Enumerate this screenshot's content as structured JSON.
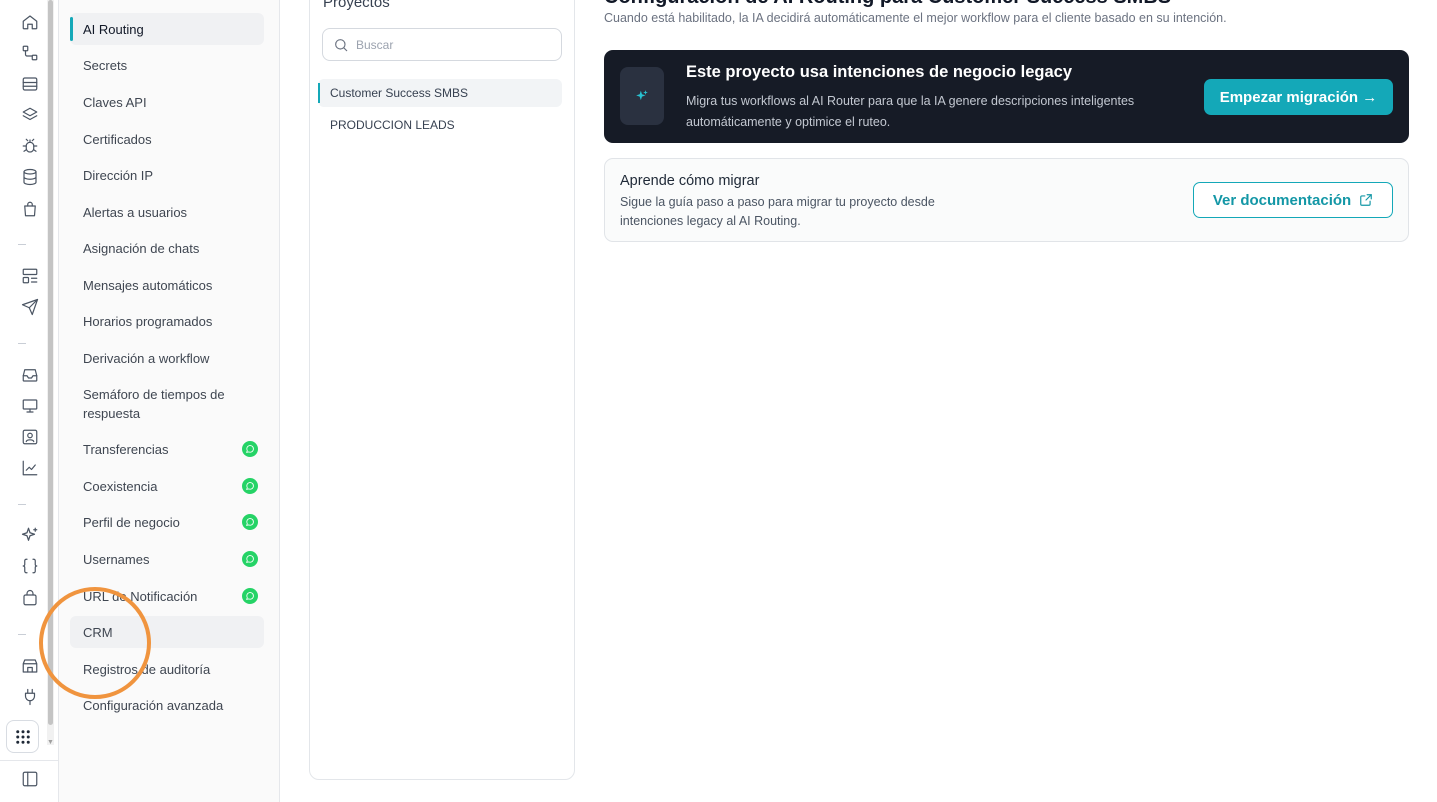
{
  "rail": {
    "icons": [
      "home-icon",
      "workflow-icon",
      "archive-icon",
      "layers-icon",
      "bug-icon",
      "database-icon",
      "shopping-bag-icon",
      "layout-list-icon",
      "send-icon",
      "inbox-icon",
      "monitor-icon",
      "contact-icon",
      "chart-line-icon",
      "sparkles-icon",
      "braces-icon",
      "shopping-basket-icon",
      "store-icon",
      "plug-icon",
      "apps-grid-icon",
      "sidebar-toggle-icon"
    ]
  },
  "nav": {
    "items": [
      {
        "label": "AI Routing",
        "active": true
      },
      {
        "label": "Secrets"
      },
      {
        "label": "Claves API"
      },
      {
        "label": "Certificados"
      },
      {
        "label": "Dirección IP"
      },
      {
        "label": "Alertas a usuarios"
      },
      {
        "label": "Asignación de chats"
      },
      {
        "label": "Mensajes automáticos"
      },
      {
        "label": "Horarios programados"
      },
      {
        "label": "Derivación a workflow"
      },
      {
        "label": "Semáforo de tiempos de respuesta"
      },
      {
        "label": "Transferencias",
        "badge": "whatsapp-icon"
      },
      {
        "label": "Coexistencia",
        "badge": "whatsapp-icon"
      },
      {
        "label": "Perfil de negocio",
        "badge": "whatsapp-icon"
      },
      {
        "label": "Usernames",
        "badge": "whatsapp-icon"
      },
      {
        "label": "URL de Notificación",
        "badge": "whatsapp-icon"
      },
      {
        "label": "CRM",
        "hover": true
      },
      {
        "label": "Registros de auditoría"
      },
      {
        "label": "Configuración avanzada"
      }
    ]
  },
  "projects": {
    "title": "Proyectos",
    "search_placeholder": "Buscar",
    "items": [
      {
        "label": "Customer Success SMBS",
        "active": true
      },
      {
        "label": "PRODUCCION LEADS"
      }
    ]
  },
  "main": {
    "title": "Configuración de AI Routing para Customer Success SMBS",
    "subtitle": "Cuando está habilitado, la IA decidirá automáticamente el mejor workflow para el cliente basado en su intención.",
    "banner": {
      "title": "Este proyecto usa intenciones de negocio legacy",
      "description": "Migra tus workflows al AI Router para que la IA genere descripciones inteligentes automáticamente y optimice el ruteo.",
      "button": "Empezar migración →"
    },
    "card": {
      "title": "Aprende cómo migrar",
      "description": "Sigue la guía paso a paso para migrar tu proyecto desde intenciones legacy al AI Routing.",
      "button": "Ver documentación"
    }
  },
  "colors": {
    "accent": "#14a8b8",
    "banner_bg": "#161b26",
    "whatsapp": "#25d366",
    "highlight_ring": "#f0943e"
  }
}
